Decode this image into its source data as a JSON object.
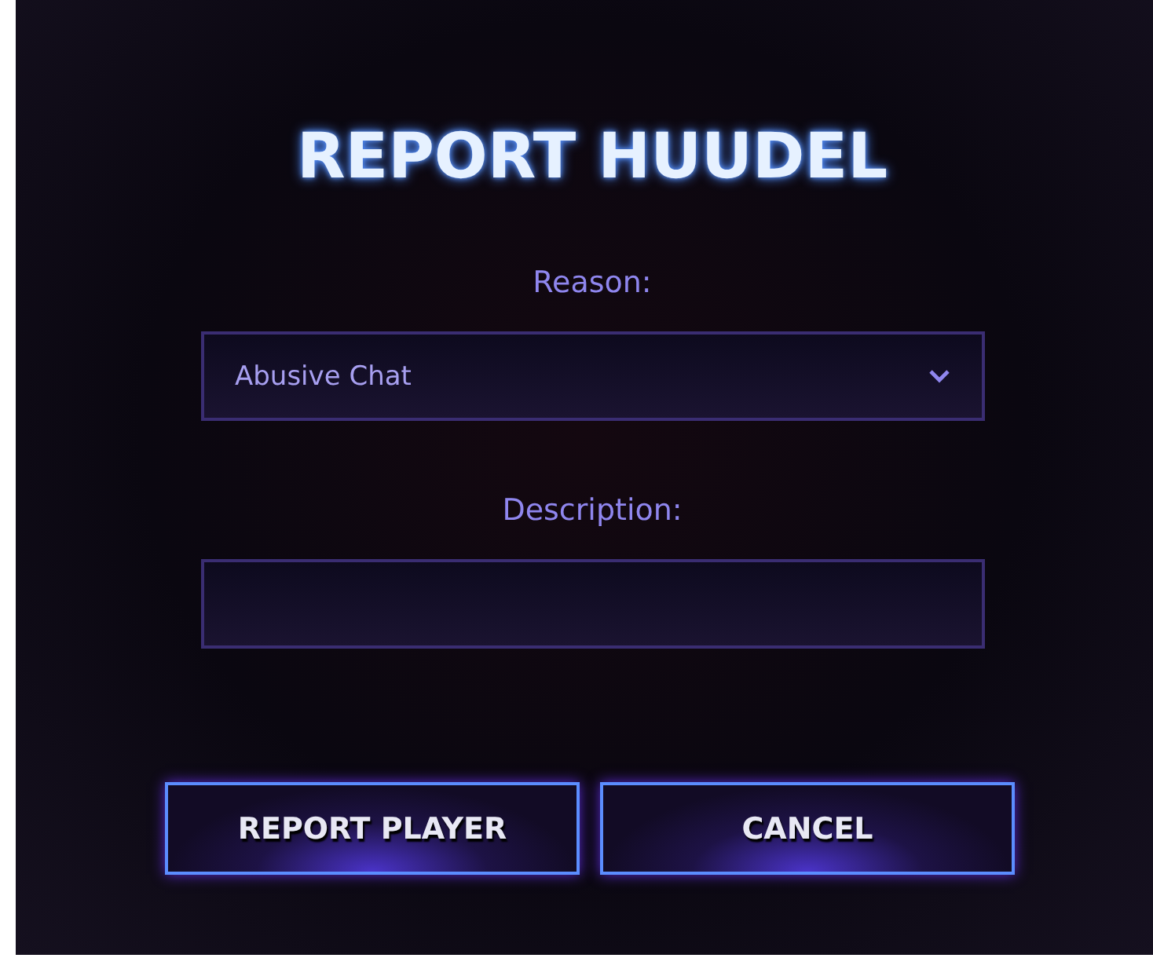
{
  "title": "REPORT HUUDEL",
  "reason": {
    "label": "Reason:",
    "value": "Abusive Chat"
  },
  "description": {
    "label": "Description:"
  },
  "buttons": [
    {
      "label": "REPORT PLAYER"
    },
    {
      "label": "CANCEL"
    }
  ]
}
